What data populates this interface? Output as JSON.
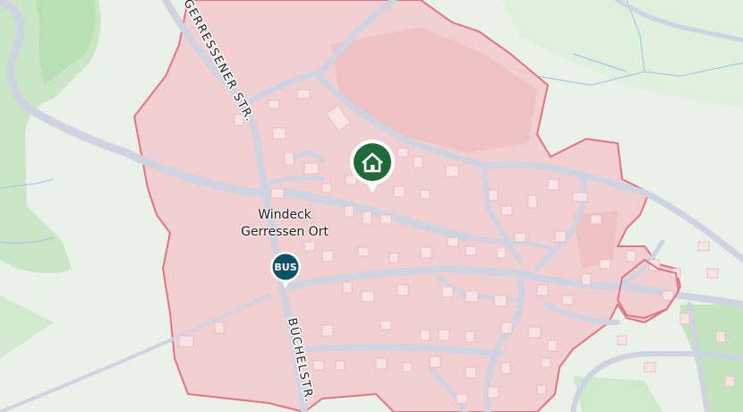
{
  "map": {
    "place_name_line1": "Windeck",
    "place_name_line2": "Gerressen Ort",
    "roads": {
      "north": "GERRESSENER STR.",
      "south": "BÜCHELSTR."
    },
    "markers": {
      "home": {
        "icon": "home-icon",
        "color": "#1e6b3a"
      },
      "bus": {
        "label": "BUS",
        "icon": "bus-stop-icon",
        "color": "#0d5166"
      }
    },
    "colors": {
      "background": "#e8f0e8",
      "forest": "#c7e6c4",
      "area_fill": "#f2c9cc",
      "area_border": "#e0707e",
      "road": "#c9d0de",
      "building": "#f7e1e1",
      "water": "#a8c8e8"
    }
  }
}
